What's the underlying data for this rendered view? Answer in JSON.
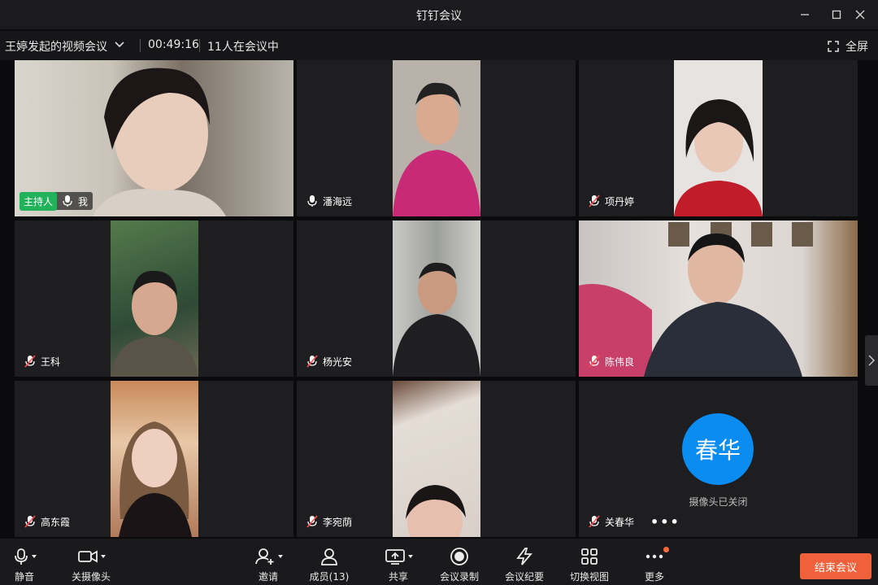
{
  "window": {
    "title": "钉钉会议"
  },
  "infobar": {
    "meeting_name": "王婷发起的视频会议",
    "timer": "00:49:16",
    "participants_status": "11人在会议中",
    "fullscreen_label": "全屏"
  },
  "tiles": [
    {
      "name": "我",
      "host_badge": "主持人",
      "mic": "on",
      "bg": "#8a8478"
    },
    {
      "name": "潘海远",
      "mic": "on",
      "bg": "#b22a6a"
    },
    {
      "name": "项丹婷",
      "mic": "muted",
      "bg": "#d8d5d2"
    },
    {
      "name": "王科",
      "mic": "muted",
      "bg": "#3b5a3e"
    },
    {
      "name": "杨光安",
      "mic": "muted",
      "bg": "#aeb0ae"
    },
    {
      "name": "陈伟良",
      "mic": "muted",
      "bg": "#9a9493"
    },
    {
      "name": "高东霞",
      "mic": "muted",
      "bg": "#b88a66"
    },
    {
      "name": "李宛荫",
      "mic": "muted",
      "bg": "#d8d2cc"
    },
    {
      "name": "关春华",
      "mic": "muted",
      "avatar_text": "春华",
      "camera_status": "摄像头已关闭",
      "more": "•••"
    }
  ],
  "toolbar": {
    "mute": "静音",
    "camera_off": "关摄像头",
    "invite": "邀请",
    "members": "成员(13)",
    "share": "共享",
    "record": "会议录制",
    "minutes": "会议纪要",
    "switch_view": "切换视图",
    "more": "更多",
    "end_meeting": "结束会议"
  },
  "colors": {
    "accent_green": "#22b25a",
    "avatar_blue": "#0a8cf0",
    "end_button": "#f0603a"
  }
}
